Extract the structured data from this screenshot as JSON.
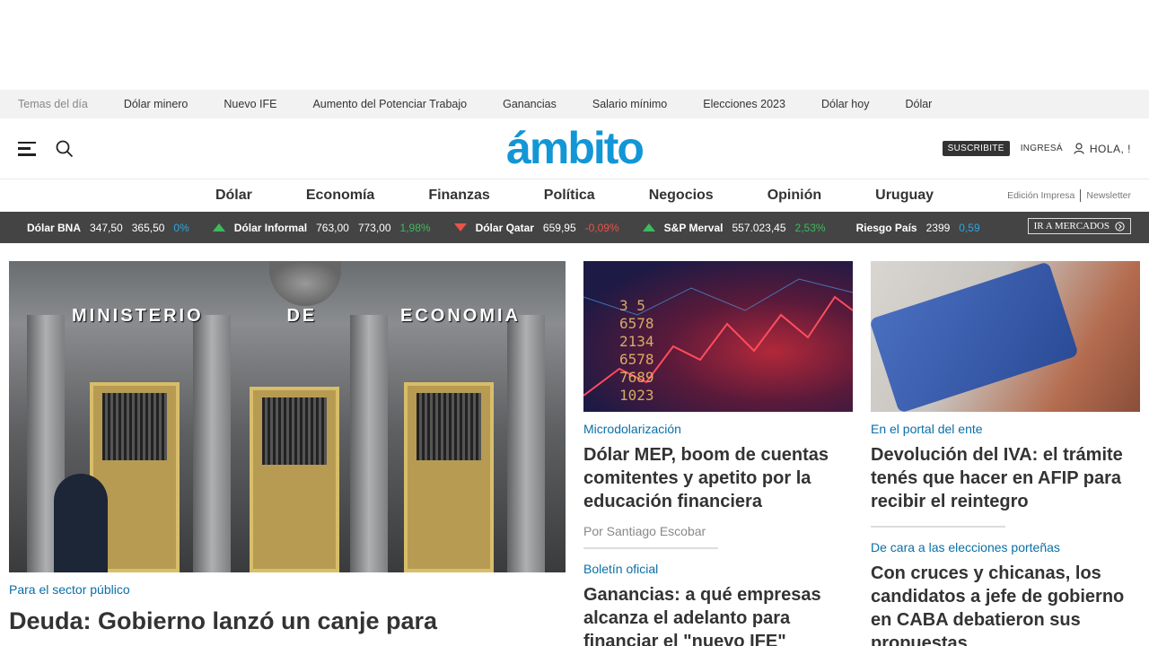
{
  "topics_bar": {
    "label": "Temas del día",
    "items": [
      "Dólar minero",
      "Nuevo IFE",
      "Aumento del Potenciar Trabajo",
      "Ganancias",
      "Salario mínimo",
      "Elecciones 2023",
      "Dólar hoy",
      "Dólar"
    ]
  },
  "header": {
    "logo": "ámbito",
    "subscribe": "SUSCRIBITE",
    "login": "INGRESÁ",
    "greeting": "HOLA, !"
  },
  "nav": {
    "items": [
      "Dólar",
      "Economía",
      "Finanzas",
      "Política",
      "Negocios",
      "Opinión",
      "Uruguay"
    ],
    "print_edition": "Edición Impresa",
    "newsletter": "Newsletter"
  },
  "ticker": {
    "items": [
      {
        "name": "Dólar BNA",
        "v1": "347,50",
        "v2": "365,50",
        "pct": "0%",
        "trend": "flat"
      },
      {
        "name": "Dólar Informal",
        "v1": "763,00",
        "v2": "773,00",
        "pct": "1,98%",
        "trend": "up"
      },
      {
        "name": "Dólar Qatar",
        "v1": "659,95",
        "v2": "",
        "pct": "-0,09%",
        "trend": "down"
      },
      {
        "name": "S&P Merval",
        "v1": "557.023,45",
        "v2": "",
        "pct": "2,53%",
        "trend": "up"
      },
      {
        "name": "Riesgo País",
        "v1": "2399",
        "v2": "",
        "pct": "0,59",
        "trend": "flat"
      }
    ],
    "markets_button": "IR A MERCADOS"
  },
  "main_article": {
    "image_sign": [
      "MINISTERIO",
      "DE",
      "ECONOMIA"
    ],
    "kicker": "Para el sector público",
    "title": "Deuda: Gobierno lanzó un canje para"
  },
  "col2": {
    "a1": {
      "kicker": "Microdolarización",
      "title": "Dólar MEP, boom de cuentas comitentes y apetito por la educación financiera",
      "author": "Por Santiago Escobar",
      "image_numbers": "3 5\n6578\n2134\n6578\n7689\n1023"
    },
    "a2": {
      "kicker": "Boletín oficial",
      "title": "Ganancias: a qué empresas alcanza el adelanto para financiar el \"nuevo IFE\""
    }
  },
  "col3": {
    "a1": {
      "kicker": "En el portal del ente",
      "title": "Devolución del IVA: el trámite tenés que hacer en AFIP para recibir el reintegro"
    },
    "a2": {
      "kicker": "De cara a las elecciones porteñas",
      "title": "Con cruces y chicanas, los candidatos a jefe de gobierno en CABA debatieron sus propuestas"
    }
  }
}
